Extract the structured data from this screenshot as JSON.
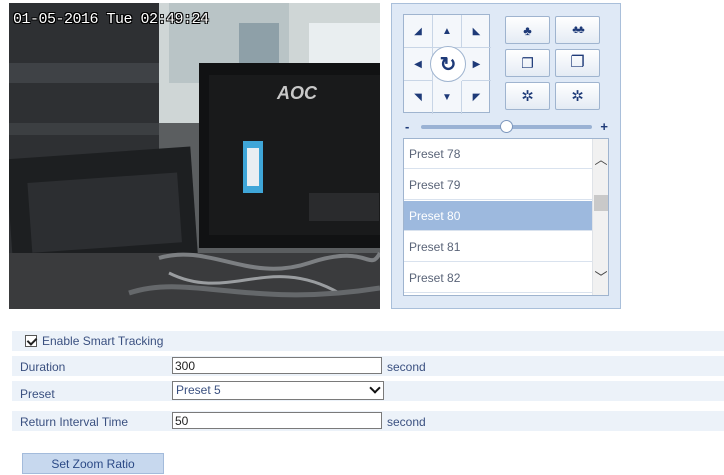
{
  "live_view": {
    "osd_timestamp": "01-05-2016 Tue 02:49:24",
    "monitor_brand": "AOC"
  },
  "ptz": {
    "direction_buttons": [
      {
        "name": "pan-up-left",
        "icon": "arrow-down-right-icon",
        "glyph": "◢"
      },
      {
        "name": "pan-up",
        "icon": "arrow-up-icon",
        "glyph": "▲"
      },
      {
        "name": "pan-up-right",
        "icon": "arrow-down-left-icon",
        "glyph": "◣"
      },
      {
        "name": "pan-left",
        "icon": "arrow-left-icon",
        "glyph": "◀"
      },
      {
        "name": "pan-right",
        "icon": "arrow-right-icon",
        "glyph": "▶"
      },
      {
        "name": "pan-down-left",
        "icon": "arrow-up-right-icon",
        "glyph": "◥"
      },
      {
        "name": "pan-down",
        "icon": "arrow-down-icon",
        "glyph": "▼"
      },
      {
        "name": "pan-down-right",
        "icon": "arrow-up-left-icon",
        "glyph": "◤"
      }
    ],
    "auto_pan_glyph": "↻",
    "lens_buttons": [
      {
        "name": "zoom-in-button",
        "icon": "tree-small-icon",
        "glyph": "♣"
      },
      {
        "name": "zoom-out-button",
        "icon": "tree-group-icon",
        "glyph": "♣♣"
      },
      {
        "name": "focus-near-button",
        "icon": "square-small-icon",
        "glyph": "❐"
      },
      {
        "name": "focus-far-button",
        "icon": "square-large-icon",
        "glyph": "❐"
      },
      {
        "name": "iris-open-button",
        "icon": "iris-open-icon",
        "glyph": "✲"
      },
      {
        "name": "iris-close-button",
        "icon": "iris-close-icon",
        "glyph": "✲"
      }
    ],
    "speed": {
      "minus": "-",
      "plus": "+",
      "level": 0.5
    },
    "presets": [
      {
        "label": "Preset 78",
        "selected": false
      },
      {
        "label": "Preset 79",
        "selected": false
      },
      {
        "label": "Preset 80",
        "selected": true
      },
      {
        "label": "Preset 81",
        "selected": false
      },
      {
        "label": "Preset 82",
        "selected": false
      }
    ],
    "scroll_up_glyph": "︿",
    "scroll_down_glyph": "﹀"
  },
  "smart_tracking": {
    "enable_label": "Enable Smart Tracking",
    "enabled": true,
    "duration_label": "Duration",
    "duration_value": "300",
    "duration_unit": "second",
    "preset_label": "Preset",
    "preset_value": "Preset 5",
    "return_label": "Return Interval Time",
    "return_value": "50",
    "return_unit": "second",
    "zoom_button": "Set Zoom Ratio"
  },
  "colors": {
    "panel_bg": "#dfe9f6",
    "row_bg": "#ecf2f9",
    "selected_preset": "#9db9de",
    "button_bg": "#c7d8ee",
    "text": "#3a5080"
  }
}
